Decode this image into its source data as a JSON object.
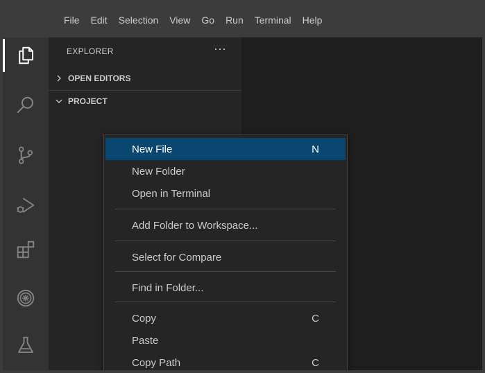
{
  "menubar": {
    "items": [
      "File",
      "Edit",
      "Selection",
      "View",
      "Go",
      "Run",
      "Terminal",
      "Help"
    ]
  },
  "activitybar": {
    "icons": [
      "explorer-icon",
      "search-icon",
      "source-control-icon",
      "run-debug-icon",
      "extensions-icon",
      "remote-icon",
      "testing-icon"
    ],
    "active": "explorer-icon"
  },
  "sidebar": {
    "title": "EXPLORER",
    "more": "···",
    "sections": [
      {
        "label": "OPEN EDITORS",
        "expanded": false
      },
      {
        "label": "PROJECT",
        "expanded": true
      }
    ]
  },
  "context_menu": {
    "items": [
      {
        "label": "New File",
        "key": "N",
        "selected": true
      },
      {
        "label": "New Folder",
        "key": ""
      },
      {
        "label": "Open in Terminal",
        "key": ""
      },
      {
        "label": "Add Folder to Workspace...",
        "key": ""
      },
      {
        "label": "Select for Compare",
        "key": ""
      },
      {
        "label": "Find in Folder...",
        "key": ""
      },
      {
        "label": "Copy",
        "key": "C"
      },
      {
        "label": "Paste",
        "key": ""
      },
      {
        "label": "Copy Path",
        "key": "C"
      }
    ]
  },
  "colors": {
    "menubar_bg": "#3c3c3c",
    "activitybar_bg": "#333333",
    "sidebar_bg": "#252526",
    "editor_bg": "#1e1e1e",
    "selection_bg": "#094771"
  }
}
